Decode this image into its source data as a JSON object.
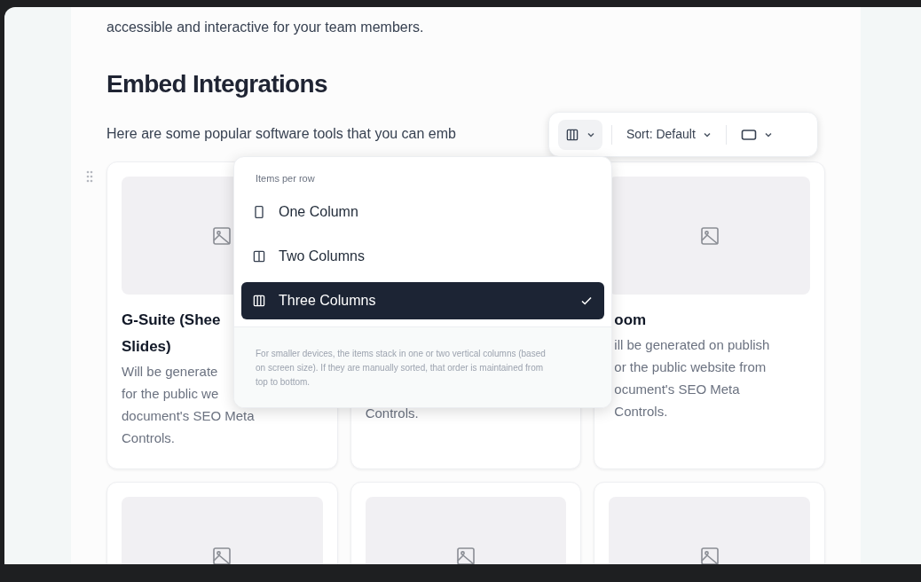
{
  "intro_text": "accessible and interactive for your team members.",
  "heading": "Embed Integrations",
  "lead_text": "Here are some popular software tools that you can emb",
  "toolbar": {
    "layout_button": {
      "open": true
    },
    "sort_button": {
      "label": "Sort: Default"
    },
    "size_button": {
      "open": false
    }
  },
  "layout_menu": {
    "header": "Items per row",
    "options": [
      {
        "label": "One Column",
        "kind": "one",
        "selected": false
      },
      {
        "label": "Two Columns",
        "kind": "two",
        "selected": false
      },
      {
        "label": "Three Columns",
        "kind": "three",
        "selected": true
      }
    ],
    "note": "For smaller devices, the items stack in one or two vertical columns (based on screen size). If they are manually sorted, that order is maintained from top to bottom."
  },
  "cards": [
    {
      "kind": "text",
      "title_lines": [
        "G-Suite (Shee",
        "Slides)"
      ],
      "body_lines": [
        "Will be generate",
        "for the public we",
        "document's SEO Meta",
        "Controls."
      ]
    },
    {
      "kind": "text",
      "body_lines": [
        "Controls."
      ]
    },
    {
      "kind": "text",
      "title_lines": [
        "oom"
      ],
      "body_lines": [
        "ill be generated on publish",
        "or the public website from",
        "ocument's SEO Meta",
        "Controls."
      ]
    },
    {
      "kind": "image_only"
    },
    {
      "kind": "image_only"
    },
    {
      "kind": "image_only"
    }
  ]
}
